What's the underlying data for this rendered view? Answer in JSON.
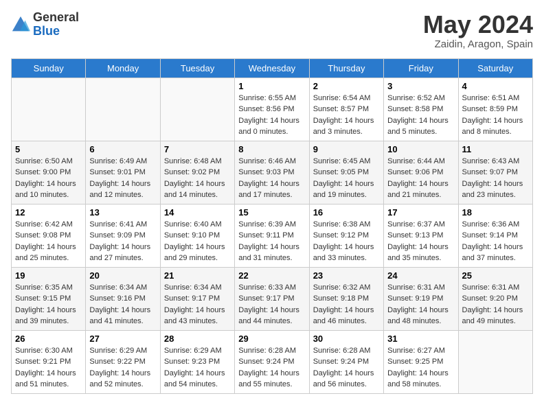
{
  "header": {
    "logo_general": "General",
    "logo_blue": "Blue",
    "title": "May 2024",
    "location": "Zaidin, Aragon, Spain"
  },
  "weekdays": [
    "Sunday",
    "Monday",
    "Tuesday",
    "Wednesday",
    "Thursday",
    "Friday",
    "Saturday"
  ],
  "weeks": [
    [
      {
        "day": "",
        "sunrise": "",
        "sunset": "",
        "daylight": ""
      },
      {
        "day": "",
        "sunrise": "",
        "sunset": "",
        "daylight": ""
      },
      {
        "day": "",
        "sunrise": "",
        "sunset": "",
        "daylight": ""
      },
      {
        "day": "1",
        "sunrise": "Sunrise: 6:55 AM",
        "sunset": "Sunset: 8:56 PM",
        "daylight": "Daylight: 14 hours and 0 minutes."
      },
      {
        "day": "2",
        "sunrise": "Sunrise: 6:54 AM",
        "sunset": "Sunset: 8:57 PM",
        "daylight": "Daylight: 14 hours and 3 minutes."
      },
      {
        "day": "3",
        "sunrise": "Sunrise: 6:52 AM",
        "sunset": "Sunset: 8:58 PM",
        "daylight": "Daylight: 14 hours and 5 minutes."
      },
      {
        "day": "4",
        "sunrise": "Sunrise: 6:51 AM",
        "sunset": "Sunset: 8:59 PM",
        "daylight": "Daylight: 14 hours and 8 minutes."
      }
    ],
    [
      {
        "day": "5",
        "sunrise": "Sunrise: 6:50 AM",
        "sunset": "Sunset: 9:00 PM",
        "daylight": "Daylight: 14 hours and 10 minutes."
      },
      {
        "day": "6",
        "sunrise": "Sunrise: 6:49 AM",
        "sunset": "Sunset: 9:01 PM",
        "daylight": "Daylight: 14 hours and 12 minutes."
      },
      {
        "day": "7",
        "sunrise": "Sunrise: 6:48 AM",
        "sunset": "Sunset: 9:02 PM",
        "daylight": "Daylight: 14 hours and 14 minutes."
      },
      {
        "day": "8",
        "sunrise": "Sunrise: 6:46 AM",
        "sunset": "Sunset: 9:03 PM",
        "daylight": "Daylight: 14 hours and 17 minutes."
      },
      {
        "day": "9",
        "sunrise": "Sunrise: 6:45 AM",
        "sunset": "Sunset: 9:05 PM",
        "daylight": "Daylight: 14 hours and 19 minutes."
      },
      {
        "day": "10",
        "sunrise": "Sunrise: 6:44 AM",
        "sunset": "Sunset: 9:06 PM",
        "daylight": "Daylight: 14 hours and 21 minutes."
      },
      {
        "day": "11",
        "sunrise": "Sunrise: 6:43 AM",
        "sunset": "Sunset: 9:07 PM",
        "daylight": "Daylight: 14 hours and 23 minutes."
      }
    ],
    [
      {
        "day": "12",
        "sunrise": "Sunrise: 6:42 AM",
        "sunset": "Sunset: 9:08 PM",
        "daylight": "Daylight: 14 hours and 25 minutes."
      },
      {
        "day": "13",
        "sunrise": "Sunrise: 6:41 AM",
        "sunset": "Sunset: 9:09 PM",
        "daylight": "Daylight: 14 hours and 27 minutes."
      },
      {
        "day": "14",
        "sunrise": "Sunrise: 6:40 AM",
        "sunset": "Sunset: 9:10 PM",
        "daylight": "Daylight: 14 hours and 29 minutes."
      },
      {
        "day": "15",
        "sunrise": "Sunrise: 6:39 AM",
        "sunset": "Sunset: 9:11 PM",
        "daylight": "Daylight: 14 hours and 31 minutes."
      },
      {
        "day": "16",
        "sunrise": "Sunrise: 6:38 AM",
        "sunset": "Sunset: 9:12 PM",
        "daylight": "Daylight: 14 hours and 33 minutes."
      },
      {
        "day": "17",
        "sunrise": "Sunrise: 6:37 AM",
        "sunset": "Sunset: 9:13 PM",
        "daylight": "Daylight: 14 hours and 35 minutes."
      },
      {
        "day": "18",
        "sunrise": "Sunrise: 6:36 AM",
        "sunset": "Sunset: 9:14 PM",
        "daylight": "Daylight: 14 hours and 37 minutes."
      }
    ],
    [
      {
        "day": "19",
        "sunrise": "Sunrise: 6:35 AM",
        "sunset": "Sunset: 9:15 PM",
        "daylight": "Daylight: 14 hours and 39 minutes."
      },
      {
        "day": "20",
        "sunrise": "Sunrise: 6:34 AM",
        "sunset": "Sunset: 9:16 PM",
        "daylight": "Daylight: 14 hours and 41 minutes."
      },
      {
        "day": "21",
        "sunrise": "Sunrise: 6:34 AM",
        "sunset": "Sunset: 9:17 PM",
        "daylight": "Daylight: 14 hours and 43 minutes."
      },
      {
        "day": "22",
        "sunrise": "Sunrise: 6:33 AM",
        "sunset": "Sunset: 9:17 PM",
        "daylight": "Daylight: 14 hours and 44 minutes."
      },
      {
        "day": "23",
        "sunrise": "Sunrise: 6:32 AM",
        "sunset": "Sunset: 9:18 PM",
        "daylight": "Daylight: 14 hours and 46 minutes."
      },
      {
        "day": "24",
        "sunrise": "Sunrise: 6:31 AM",
        "sunset": "Sunset: 9:19 PM",
        "daylight": "Daylight: 14 hours and 48 minutes."
      },
      {
        "day": "25",
        "sunrise": "Sunrise: 6:31 AM",
        "sunset": "Sunset: 9:20 PM",
        "daylight": "Daylight: 14 hours and 49 minutes."
      }
    ],
    [
      {
        "day": "26",
        "sunrise": "Sunrise: 6:30 AM",
        "sunset": "Sunset: 9:21 PM",
        "daylight": "Daylight: 14 hours and 51 minutes."
      },
      {
        "day": "27",
        "sunrise": "Sunrise: 6:29 AM",
        "sunset": "Sunset: 9:22 PM",
        "daylight": "Daylight: 14 hours and 52 minutes."
      },
      {
        "day": "28",
        "sunrise": "Sunrise: 6:29 AM",
        "sunset": "Sunset: 9:23 PM",
        "daylight": "Daylight: 14 hours and 54 minutes."
      },
      {
        "day": "29",
        "sunrise": "Sunrise: 6:28 AM",
        "sunset": "Sunset: 9:24 PM",
        "daylight": "Daylight: 14 hours and 55 minutes."
      },
      {
        "day": "30",
        "sunrise": "Sunrise: 6:28 AM",
        "sunset": "Sunset: 9:24 PM",
        "daylight": "Daylight: 14 hours and 56 minutes."
      },
      {
        "day": "31",
        "sunrise": "Sunrise: 6:27 AM",
        "sunset": "Sunset: 9:25 PM",
        "daylight": "Daylight: 14 hours and 58 minutes."
      },
      {
        "day": "",
        "sunrise": "",
        "sunset": "",
        "daylight": ""
      }
    ]
  ]
}
